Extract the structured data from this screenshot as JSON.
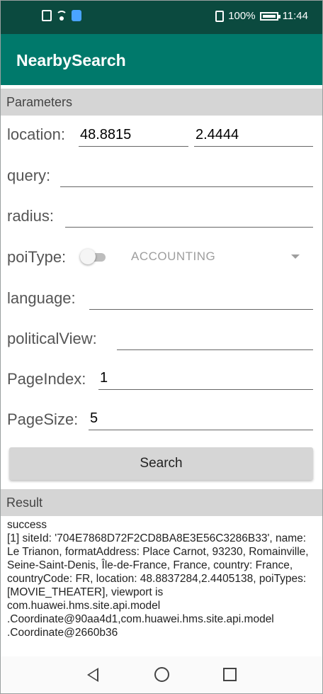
{
  "status_bar": {
    "battery": "100%",
    "time": "11:44"
  },
  "app_bar": {
    "title": "NearbySearch"
  },
  "parameters": {
    "section_title": "Parameters",
    "location": {
      "label": "location:",
      "lat": "48.8815",
      "lng": "2.4444"
    },
    "query": {
      "label": "query:",
      "value": ""
    },
    "radius": {
      "label": "radius:",
      "value": ""
    },
    "poi_type": {
      "label": "poiType:",
      "toggle_on": false,
      "selected": "ACCOUNTING"
    },
    "language": {
      "label": "language:",
      "value": ""
    },
    "political_view": {
      "label": "politicalView:",
      "value": ""
    },
    "page_index": {
      "label": "PageIndex:",
      "value": "1"
    },
    "page_size": {
      "label": "PageSize:",
      "value": "5"
    }
  },
  "search_button": {
    "label": "Search"
  },
  "result": {
    "section_title": "Result",
    "text": "success\n[1] siteId: '704E7868D72F2CD8BA8E3E56C3286B33', name: Le Trianon, formatAddress: Place Carnot, 93230, Romainville, Seine-Saint-Denis, Île-de-France, France, country: France, countryCode: FR, location: 48.8837284,2.4405138, poiTypes: [MOVIE_THEATER], viewport is com.huawei.hms.site.api.model\n.Coordinate@90aa4d1,com.huawei.hms.site.api.model\n.Coordinate@2660b36"
  },
  "nav_bar": {
    "back": "back-icon",
    "home": "home-icon",
    "recent": "recent-apps-icon"
  },
  "colors": {
    "app_bar": "#00796b",
    "status_bar": "#0b4a3f"
  }
}
